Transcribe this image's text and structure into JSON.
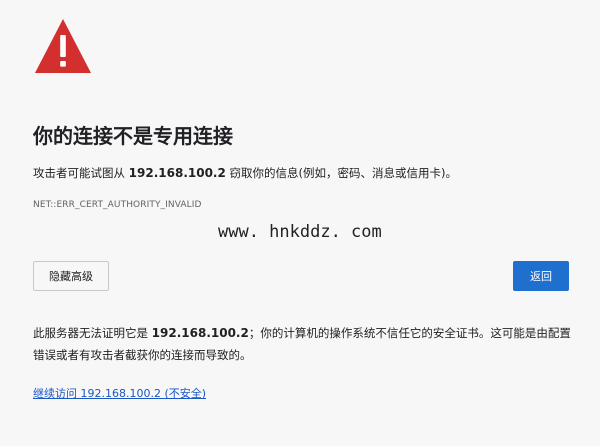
{
  "colors": {
    "warning_red": "#d32f2f",
    "primary_blue": "#1f6fcf",
    "link_blue": "#1a56c4",
    "background": "#f7f7f7"
  },
  "icon": "warning-triangle-icon",
  "title": "你的连接不是专用连接",
  "description": {
    "prefix": "攻击者可能试图从 ",
    "host": "192.168.100.2",
    "suffix": " 窃取你的信息(例如，密码、消息或信用卡)。"
  },
  "error_code": "NET::ERR_CERT_AUTHORITY_INVALID",
  "watermark": "www. hnkddz. com",
  "buttons": {
    "advanced": "隐藏高级",
    "back": "返回"
  },
  "detail": {
    "prefix": "此服务器无法证明它是 ",
    "host": "192.168.100.2",
    "suffix": "；你的计算机的操作系统不信任它的安全证书。这可能是由配置错误或者有攻击者截获你的连接而导致的。"
  },
  "proceed_link": "继续访问 192.168.100.2 (不安全)"
}
